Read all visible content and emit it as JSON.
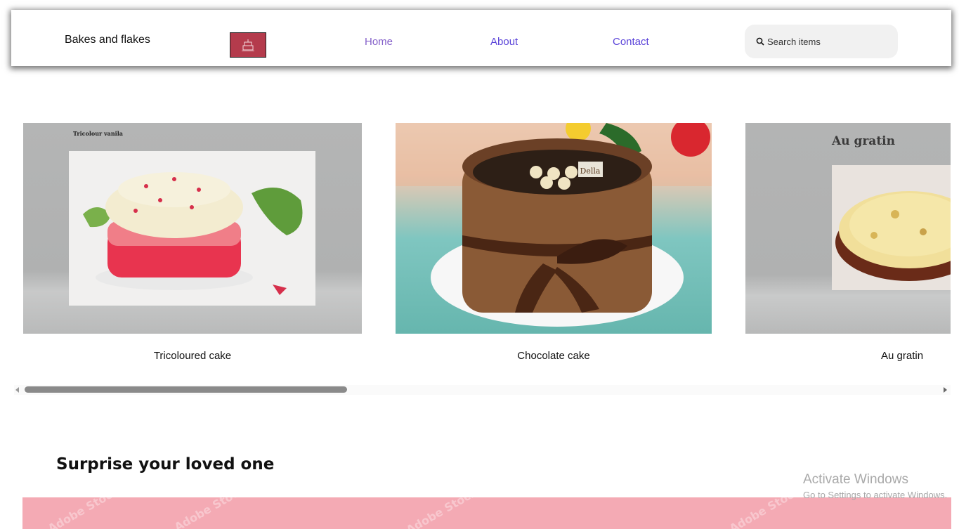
{
  "header": {
    "brand": "Bakes and flakes",
    "logo_icon": "cake-logo-icon",
    "nav": [
      {
        "label": "Home",
        "color": "#8460c9"
      },
      {
        "label": "About",
        "color": "#5b44d9"
      },
      {
        "label": "Contact",
        "color": "#5b44d9"
      }
    ],
    "search": {
      "placeholder": "Search items",
      "icon": "search-icon"
    }
  },
  "carousel": {
    "items": [
      {
        "caption": "Tricoloured cake",
        "image_text": "Tricolour vanila"
      },
      {
        "caption": "Chocolate cake",
        "image_text": "Della"
      },
      {
        "caption": "Au gratin",
        "image_text": "Au gratin"
      }
    ],
    "scroll_progress": 0.0
  },
  "section": {
    "title": "Surprise your loved one"
  },
  "watermark": {
    "line1": "Activate Windows",
    "line2": "Go to Settings to activate Windows."
  },
  "band_watermark": "Adobe Stock",
  "colors": {
    "pink_band": "#f4aab4",
    "logo_bg": "#b43b4c"
  }
}
